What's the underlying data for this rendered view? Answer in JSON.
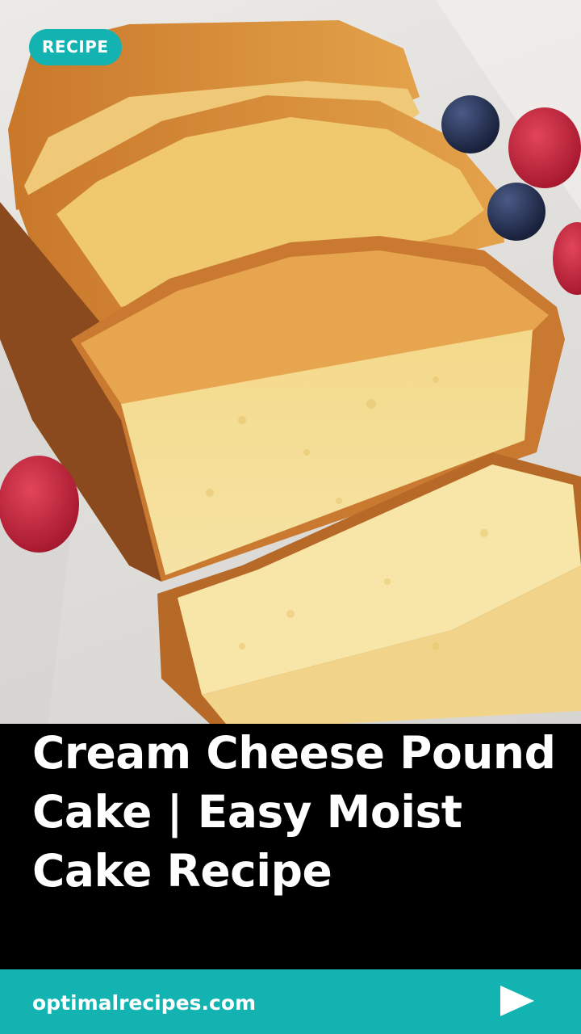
{
  "badge": {
    "label": "RECIPE"
  },
  "post": {
    "title": "Cream Cheese Pound Cake | Easy Moist Cake Recipe"
  },
  "footer": {
    "site": "optimalrecipes.com",
    "action_icon": "play-arrow-icon"
  },
  "colors": {
    "accent": "#12b3b0",
    "title_bg": "#000000",
    "text": "#ffffff"
  }
}
